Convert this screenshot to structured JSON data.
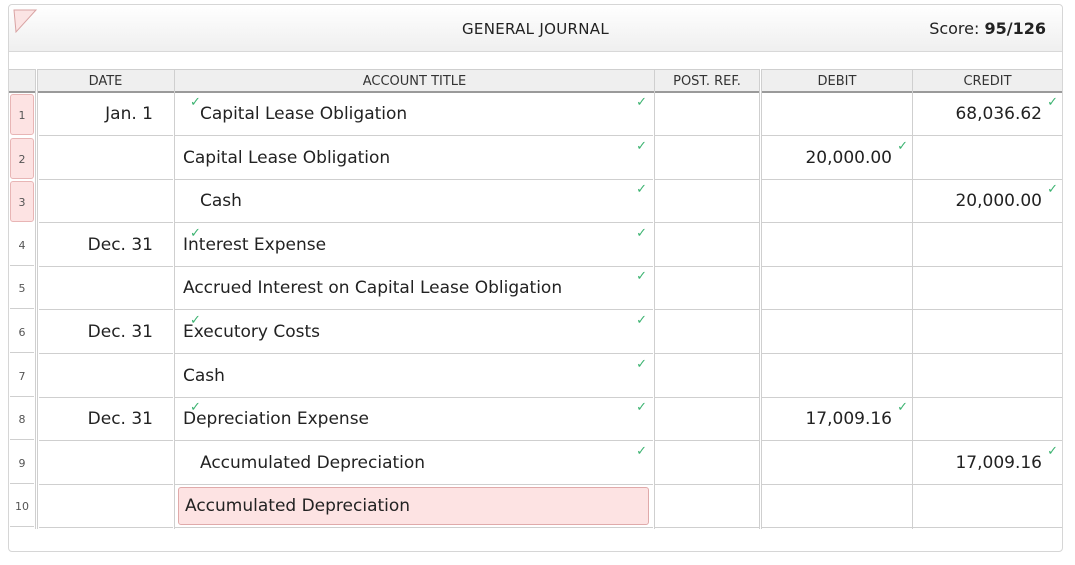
{
  "header": {
    "title": "GENERAL JOURNAL",
    "score_label": "Score:",
    "score_value": "95/126"
  },
  "columns": {
    "date": "DATE",
    "account": "ACCOUNT TITLE",
    "post_ref": "POST. REF.",
    "debit": "DEBIT",
    "credit": "CREDIT"
  },
  "rows": [
    {
      "num": "1",
      "date": "Jan. 1",
      "date_ok": true,
      "account": "Capital Lease Obligation",
      "indent": true,
      "acct_ok": true,
      "debit": "",
      "debit_ok": false,
      "credit": "68,036.62",
      "credit_ok": true,
      "num_err": true,
      "acct_err": false
    },
    {
      "num": "2",
      "date": "",
      "date_ok": false,
      "account": "Capital Lease Obligation",
      "indent": false,
      "acct_ok": true,
      "debit": "20,000.00",
      "debit_ok": true,
      "credit": "",
      "credit_ok": false,
      "num_err": true,
      "acct_err": false
    },
    {
      "num": "3",
      "date": "",
      "date_ok": false,
      "account": "Cash",
      "indent": true,
      "acct_ok": true,
      "debit": "",
      "debit_ok": false,
      "credit": "20,000.00",
      "credit_ok": true,
      "num_err": true,
      "acct_err": false
    },
    {
      "num": "4",
      "date": "Dec. 31",
      "date_ok": true,
      "account": "Interest Expense",
      "indent": false,
      "acct_ok": true,
      "debit": "",
      "debit_ok": false,
      "credit": "",
      "credit_ok": false,
      "num_err": false,
      "acct_err": false
    },
    {
      "num": "5",
      "date": "",
      "date_ok": false,
      "account": "Accrued Interest on Capital Lease Obligation",
      "indent": false,
      "acct_ok": true,
      "debit": "",
      "debit_ok": false,
      "credit": "",
      "credit_ok": false,
      "num_err": false,
      "acct_err": false
    },
    {
      "num": "6",
      "date": "Dec. 31",
      "date_ok": true,
      "account": "Executory Costs",
      "indent": false,
      "acct_ok": true,
      "debit": "",
      "debit_ok": false,
      "credit": "",
      "credit_ok": false,
      "num_err": false,
      "acct_err": false
    },
    {
      "num": "7",
      "date": "",
      "date_ok": false,
      "account": "Cash",
      "indent": false,
      "acct_ok": true,
      "debit": "",
      "debit_ok": false,
      "credit": "",
      "credit_ok": false,
      "num_err": false,
      "acct_err": false
    },
    {
      "num": "8",
      "date": "Dec. 31",
      "date_ok": true,
      "account": "Depreciation Expense",
      "indent": false,
      "acct_ok": true,
      "debit": "17,009.16",
      "debit_ok": true,
      "credit": "",
      "credit_ok": false,
      "num_err": false,
      "acct_err": false
    },
    {
      "num": "9",
      "date": "",
      "date_ok": false,
      "account": "Accumulated Depreciation",
      "indent": true,
      "acct_ok": true,
      "debit": "",
      "debit_ok": false,
      "credit": "17,009.16",
      "credit_ok": true,
      "num_err": false,
      "acct_err": false
    },
    {
      "num": "10",
      "date": "",
      "date_ok": false,
      "account": "Accumulated Depreciation",
      "indent": false,
      "acct_ok": false,
      "debit": "",
      "debit_ok": false,
      "credit": "",
      "credit_ok": false,
      "num_err": false,
      "acct_err": true
    }
  ],
  "check_glyph": "✓",
  "colors": {
    "check": "#3cb371",
    "error_bg": "#fde3e3",
    "error_border": "#e0aaaa"
  }
}
